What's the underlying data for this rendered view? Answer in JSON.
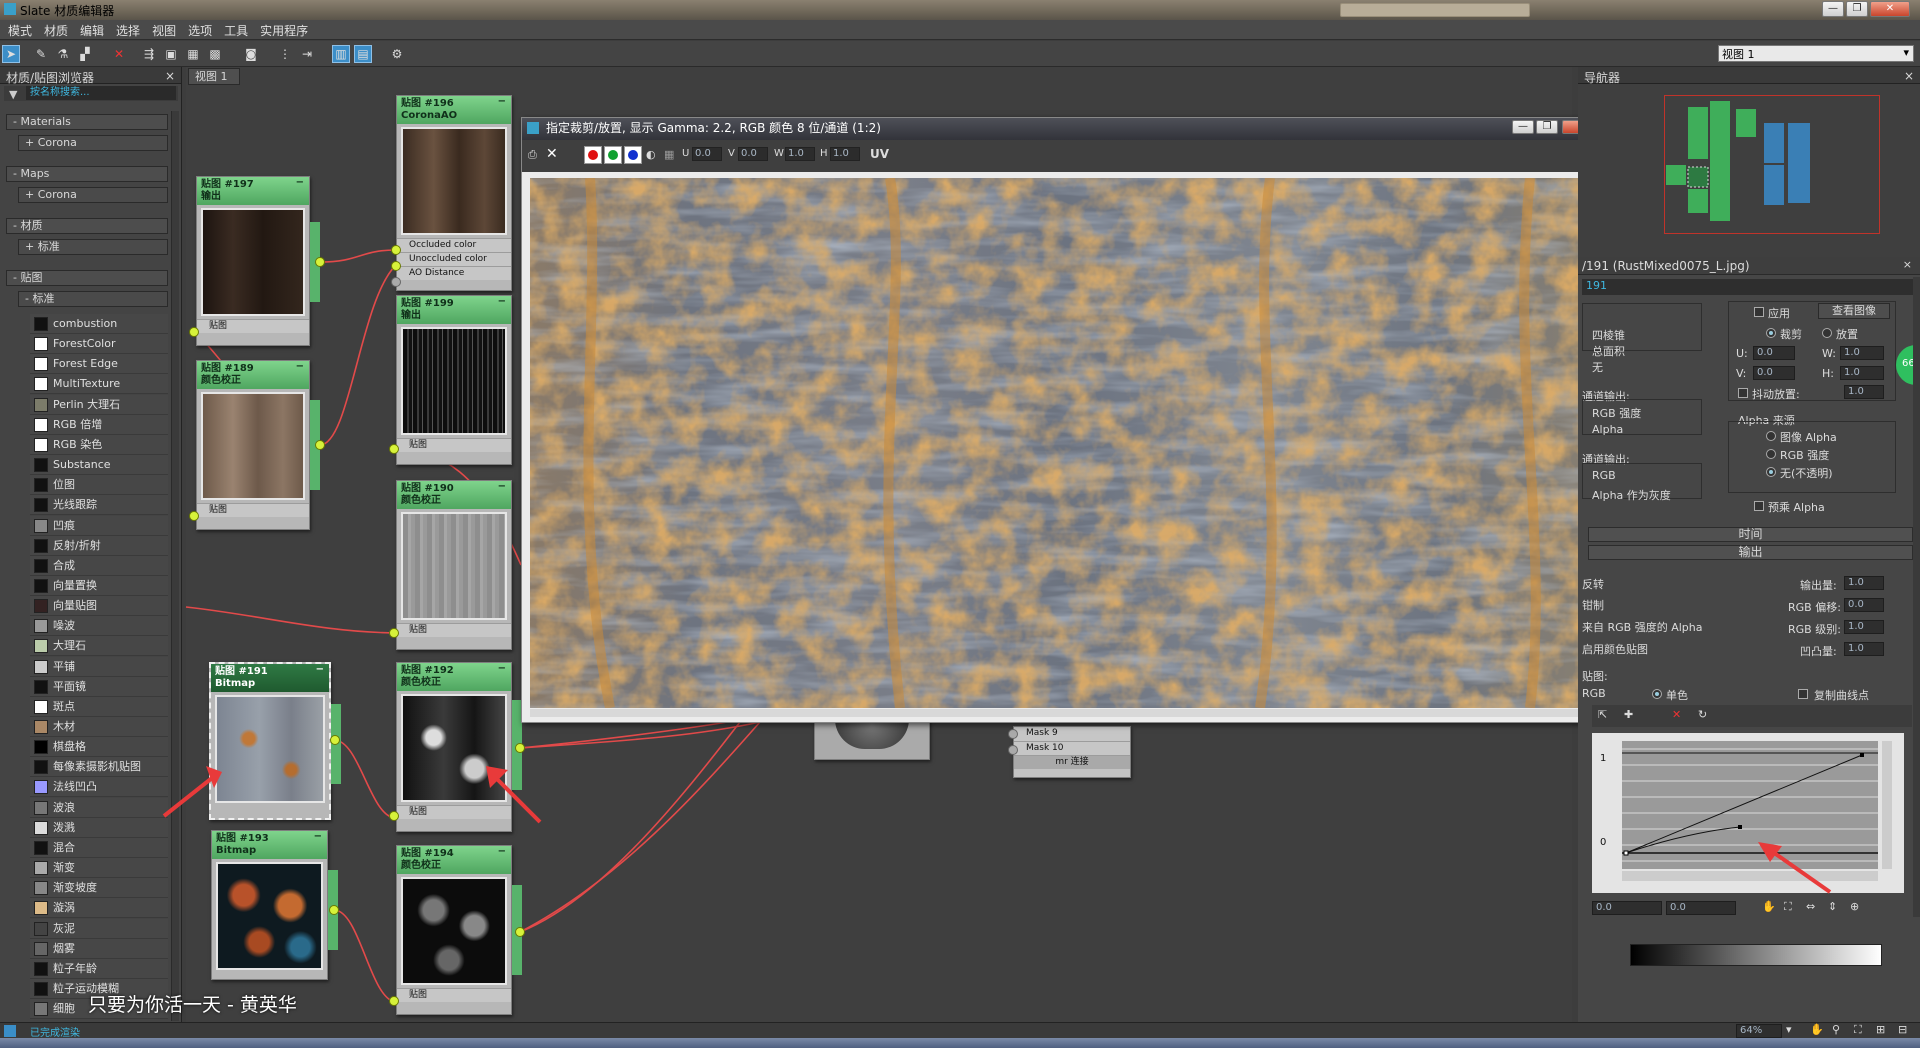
{
  "window": {
    "title": "Slate 材质编辑器"
  },
  "menu": [
    "模式",
    "材质",
    "编辑",
    "选择",
    "视图",
    "选项",
    "工具",
    "实用程序"
  ],
  "toolbar": {
    "view_select": "视图 1"
  },
  "browser": {
    "title": "材质/贴图浏览器",
    "search_placeholder": "按名称搜索...",
    "categories": [
      {
        "label": "- Materials",
        "sub": "+ Corona"
      },
      {
        "label": "- Maps",
        "sub": "+ Corona"
      },
      {
        "label": "- 材质",
        "sub": "+ 标准"
      },
      {
        "label": "- 贴图",
        "sub": "- 标准"
      }
    ],
    "map_items": [
      {
        "label": "combustion",
        "swatch": "#111"
      },
      {
        "label": "ForestColor",
        "swatch": "#fff"
      },
      {
        "label": "Forest Edge",
        "swatch": "#fff"
      },
      {
        "label": "MultiTexture",
        "swatch": "#fff"
      },
      {
        "label": "Perlin 大理石",
        "swatch": "#7c7c6a"
      },
      {
        "label": "RGB 倍增",
        "swatch": "#fff"
      },
      {
        "label": "RGB 染色",
        "swatch": "#fff"
      },
      {
        "label": "Substance",
        "swatch": "#111"
      },
      {
        "label": "位图",
        "swatch": "#111"
      },
      {
        "label": "光线跟踪",
        "swatch": "#111"
      },
      {
        "label": "凹痕",
        "swatch": "#888"
      },
      {
        "label": "反射/折射",
        "swatch": "#111"
      },
      {
        "label": "合成",
        "swatch": "#111"
      },
      {
        "label": "向量置换",
        "swatch": "#111"
      },
      {
        "label": "向量贴图",
        "swatch": "#322"
      },
      {
        "label": "噪波",
        "swatch": "#999"
      },
      {
        "label": "大理石",
        "swatch": "#bca"
      },
      {
        "label": "平铺",
        "swatch": "#ccc"
      },
      {
        "label": "平面镜",
        "swatch": "#111"
      },
      {
        "label": "斑点",
        "swatch": "#fff"
      },
      {
        "label": "木材",
        "swatch": "#a86"
      },
      {
        "label": "棋盘格",
        "swatch": "#000"
      },
      {
        "label": "每像素摄影机贴图",
        "swatch": "#111"
      },
      {
        "label": "法线凹凸",
        "swatch": "#99f"
      },
      {
        "label": "波浪",
        "swatch": "#777"
      },
      {
        "label": "泼溅",
        "swatch": "#ddd"
      },
      {
        "label": "混合",
        "swatch": "#111"
      },
      {
        "label": "渐变",
        "swatch": "#aaa"
      },
      {
        "label": "渐变坡度",
        "swatch": "#888"
      },
      {
        "label": "漩涡",
        "swatch": "#db8"
      },
      {
        "label": "灰泥",
        "swatch": "#444"
      },
      {
        "label": "烟雾",
        "swatch": "#666"
      },
      {
        "label": "粒子年龄",
        "swatch": "#111"
      },
      {
        "label": "粒子运动模糊",
        "swatch": "#111"
      },
      {
        "label": "细胞",
        "swatch": "#777"
      }
    ]
  },
  "view_tab": "视图 1",
  "nodes": {
    "n196": {
      "title": "贴图 #196",
      "subtitle": "CoronaAO",
      "slots": [
        "Occluded color",
        "Unoccluded color",
        "AO Distance"
      ]
    },
    "n197": {
      "title": "贴图 #197",
      "subtitle": "输出",
      "slot": "贴图"
    },
    "n189": {
      "title": "贴图 #189",
      "subtitle": "颜色校正",
      "slot": "贴图"
    },
    "n199": {
      "title": "贴图 #199",
      "subtitle": "输出",
      "slot": "贴图"
    },
    "n190": {
      "title": "贴图 #190",
      "subtitle": "颜色校正",
      "slot": "贴图"
    },
    "n191": {
      "title": "贴图 #191",
      "subtitle": "Bitmap"
    },
    "n192": {
      "title": "贴图 #192",
      "subtitle": "颜色校正",
      "slot": "贴图"
    },
    "n193": {
      "title": "贴图 #193",
      "subtitle": "Bitmap"
    },
    "n194": {
      "title": "贴图 #194",
      "subtitle": "颜色校正",
      "slot": "贴图"
    },
    "mask": {
      "slots": [
        "Mask 9",
        "Mask 10"
      ],
      "footer": "mr 连接"
    }
  },
  "float_window": {
    "title": "指定裁剪/放置, 显示 Gamma: 2.2, RGB 颜色 8 位/通道 (1:2)",
    "u_label": "U",
    "u_value": "0.0",
    "v_label": "V",
    "v_value": "0.0",
    "w_label": "W",
    "w_value": "1.0",
    "h_label": "H",
    "h_value": "1.0",
    "uv_label": "UV"
  },
  "navigator": {
    "title": "导航器"
  },
  "props": {
    "header": "/191 (RustMixed0075_L.jpg)",
    "subheader": "191",
    "left_top": [
      "四棱锥",
      "总面积",
      "无"
    ],
    "out_label": "通道输出:",
    "out_items": [
      "RGB 强度",
      "Alpha"
    ],
    "out_label2": "通道输出:",
    "out_items2": [
      "RGB",
      "Alpha 作为灰度"
    ],
    "apply": "应用",
    "view_image": "查看图像",
    "crop": "裁剪",
    "place": "放置",
    "u_label": "U:",
    "u_value": "0.0",
    "w_label": "W:",
    "w_value": "1.0",
    "v_label": "V:",
    "v_value": "0.0",
    "h_label": "H:",
    "h_value": "1.0",
    "jitter": "抖动放置:",
    "jitter_value": "1.0",
    "alpha_source": "Alpha 来源",
    "alpha_opts": [
      "图像 Alpha",
      "RGB 强度",
      "无(不透明)"
    ],
    "premult": "预乘 Alpha",
    "rollout_time": "时间",
    "rollout_output": "输出",
    "invert": "反转",
    "clamp": "钳制",
    "from_rgb": "来自 RGB 强度的 Alpha",
    "enable_color": "启用颜色贴图",
    "out_amount": "输出量:",
    "out_amount_v": "1.0",
    "rgb_offset": "RGB 偏移:",
    "rgb_offset_v": "0.0",
    "rgb_level": "RGB 级别:",
    "rgb_level_v": "1.0",
    "bump_amount": "凹凸量:",
    "bump_amount_v": "1.0",
    "color_map": "贴图:",
    "rgb_opt": "RGB",
    "mono_opt": "单色",
    "copy_curve": "复制曲线点",
    "curve_y1": "1",
    "curve_y0": "0",
    "curve_x_v": "0.0",
    "curve_y_v": "0.0",
    "badge": "66"
  },
  "status": {
    "text": "已完成渲染",
    "zoom": "64%"
  },
  "caption": "只要为你活一天 - 黄英华"
}
